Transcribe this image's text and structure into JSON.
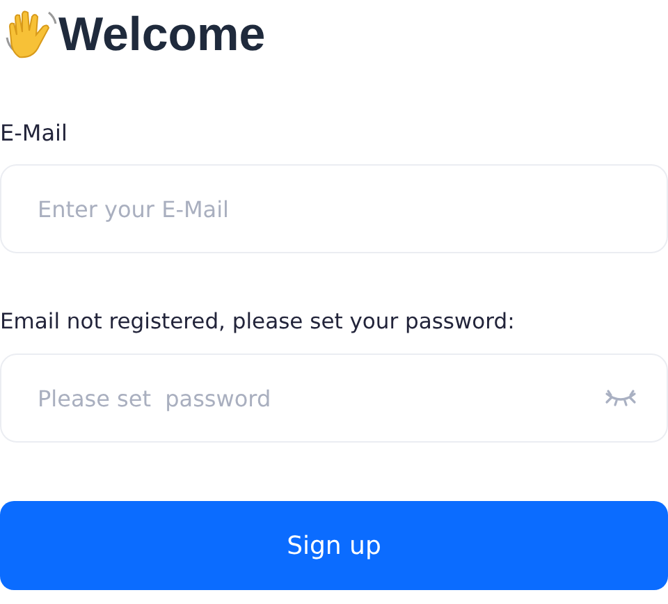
{
  "heading": "Welcome",
  "email": {
    "label": "E-Mail",
    "placeholder": "Enter your E-Mail"
  },
  "password": {
    "label": "Email not registered, please set your password:",
    "placeholder": "Please set  password",
    "visible": false
  },
  "submit": "Sign up"
}
